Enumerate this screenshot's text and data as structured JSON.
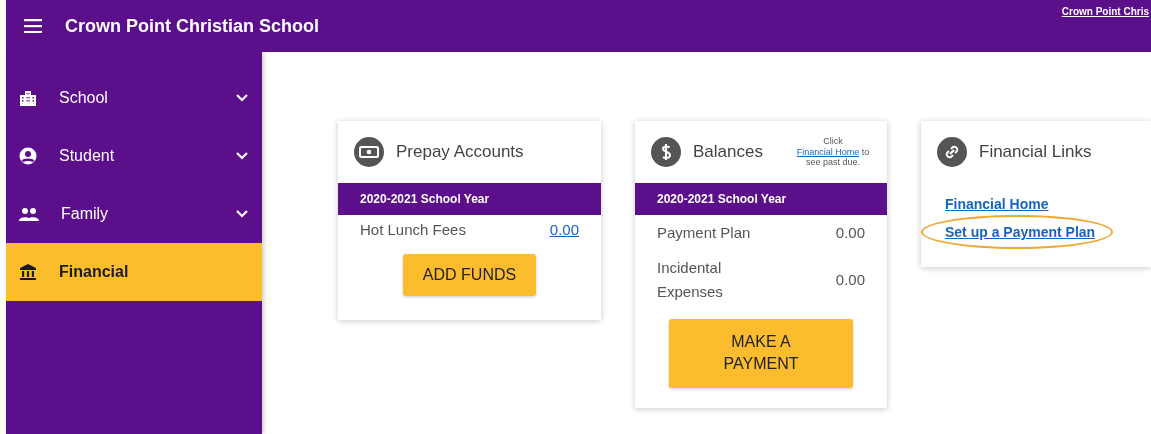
{
  "header": {
    "title": "Crown Point Christian School",
    "account_link": "Crown Point Chris"
  },
  "sidebar": {
    "items": [
      {
        "label": "School",
        "expandable": true,
        "selected": false
      },
      {
        "label": "Student",
        "expandable": true,
        "selected": false
      },
      {
        "label": "Family",
        "expandable": true,
        "selected": false
      },
      {
        "label": "Financial",
        "expandable": false,
        "selected": true
      }
    ]
  },
  "cards": [
    {
      "kind": "table",
      "title": "Prepay Accounts",
      "band": "2020-2021 School Year",
      "rows": [
        {
          "label": "Hot Lunch Fees",
          "value": "0.00",
          "kind": "link"
        }
      ],
      "button": "ADD FUNDS"
    },
    {
      "kind": "table",
      "title": "Balances",
      "note": {
        "before": "Click",
        "link": "Financial Home",
        "after": "to see past due."
      },
      "band": "2020-2021 School Year",
      "rows": [
        {
          "label": "Payment Plan",
          "value": "0.00",
          "kind": "text"
        },
        {
          "label": "Incidental Expenses",
          "value": "0.00",
          "kind": "text"
        }
      ],
      "button": "MAKE A PAYMENT"
    },
    {
      "kind": "links",
      "title": "Financial Links",
      "links": [
        {
          "label": "Financial Home",
          "highlighted": false
        },
        {
          "label": "Set up a Payment Plan",
          "highlighted": true
        }
      ]
    }
  ]
}
